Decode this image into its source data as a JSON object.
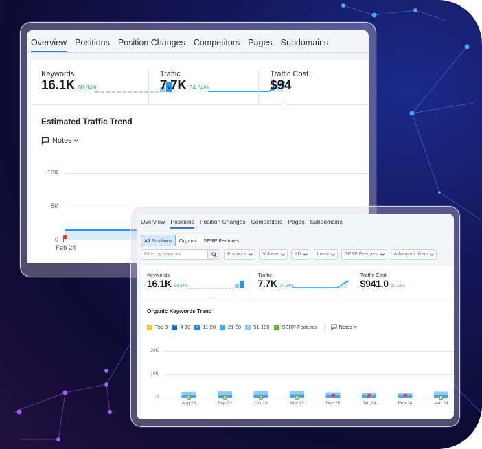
{
  "tabs": [
    "Overview",
    "Positions",
    "Position Changes",
    "Competitors",
    "Pages",
    "Subdomains"
  ],
  "window_overview": {
    "active_tab": "Overview",
    "metrics": [
      {
        "label": "Keywords",
        "value": "16.1K",
        "change": "88.84%"
      },
      {
        "label": "Traffic",
        "value": "7.7K",
        "change": "34.54%"
      },
      {
        "label": "Traffic Cost",
        "value": "$94",
        "change": ""
      }
    ],
    "section_title": "Estimated Traffic Trend",
    "notes_label": "Notes",
    "chart": {
      "y_ticks": [
        "10K",
        "5K",
        "0"
      ],
      "x_labels": [
        "Feb 24"
      ],
      "series_value_approx": 1200
    }
  },
  "window_positions": {
    "active_tab": "Positions",
    "subtabs": [
      "All Positions",
      "Organic",
      "SERP Features"
    ],
    "active_subtab": "All Positions",
    "search_placeholder": "Filter by keyword",
    "filters": [
      "Positions",
      "Volume",
      "KD",
      "Intent",
      "SERP Features",
      "Advanced filters"
    ],
    "metrics": [
      {
        "label": "Keywords",
        "value": "16.1K",
        "change": "88.84%"
      },
      {
        "label": "Traffic",
        "value": "7.7K",
        "change": "34.54%"
      },
      {
        "label": "Traffic Cost",
        "value": "$941.0",
        "change": "30.15%"
      }
    ],
    "section_title": "Organic Keywords Trend",
    "legend": [
      {
        "label": "Top 3",
        "color": "#f5c03a"
      },
      {
        "label": "4-10",
        "color": "#1565c0"
      },
      {
        "label": "11-20",
        "color": "#1e88e5"
      },
      {
        "label": "21-50",
        "color": "#42a5f5"
      },
      {
        "label": "51-100",
        "color": "#90caf9"
      },
      {
        "label": "SERP Features",
        "color": "#5bb035"
      }
    ],
    "notes_label": "Notes",
    "chart": {
      "y_ticks": [
        "20K",
        "10K",
        "0"
      ],
      "x_labels": [
        "Aug 23",
        "Sep 23",
        "Oct 23",
        "Nov 23",
        "Dec 23",
        "Jan 24",
        "Feb 24",
        "Mar 24"
      ],
      "bars_total": [
        2400,
        2600,
        2800,
        2900,
        2200,
        1900,
        1900,
        2500
      ],
      "markers": [
        "google",
        "google",
        "google",
        "google",
        "flag",
        "flag",
        "flag",
        "google"
      ]
    }
  },
  "colors": {
    "accent": "#2a7ad5",
    "positive": "#3aa86f",
    "spark_bar": "#1e9bf0",
    "spark_bar_light": "#90caf9",
    "flag": "#e53935"
  }
}
